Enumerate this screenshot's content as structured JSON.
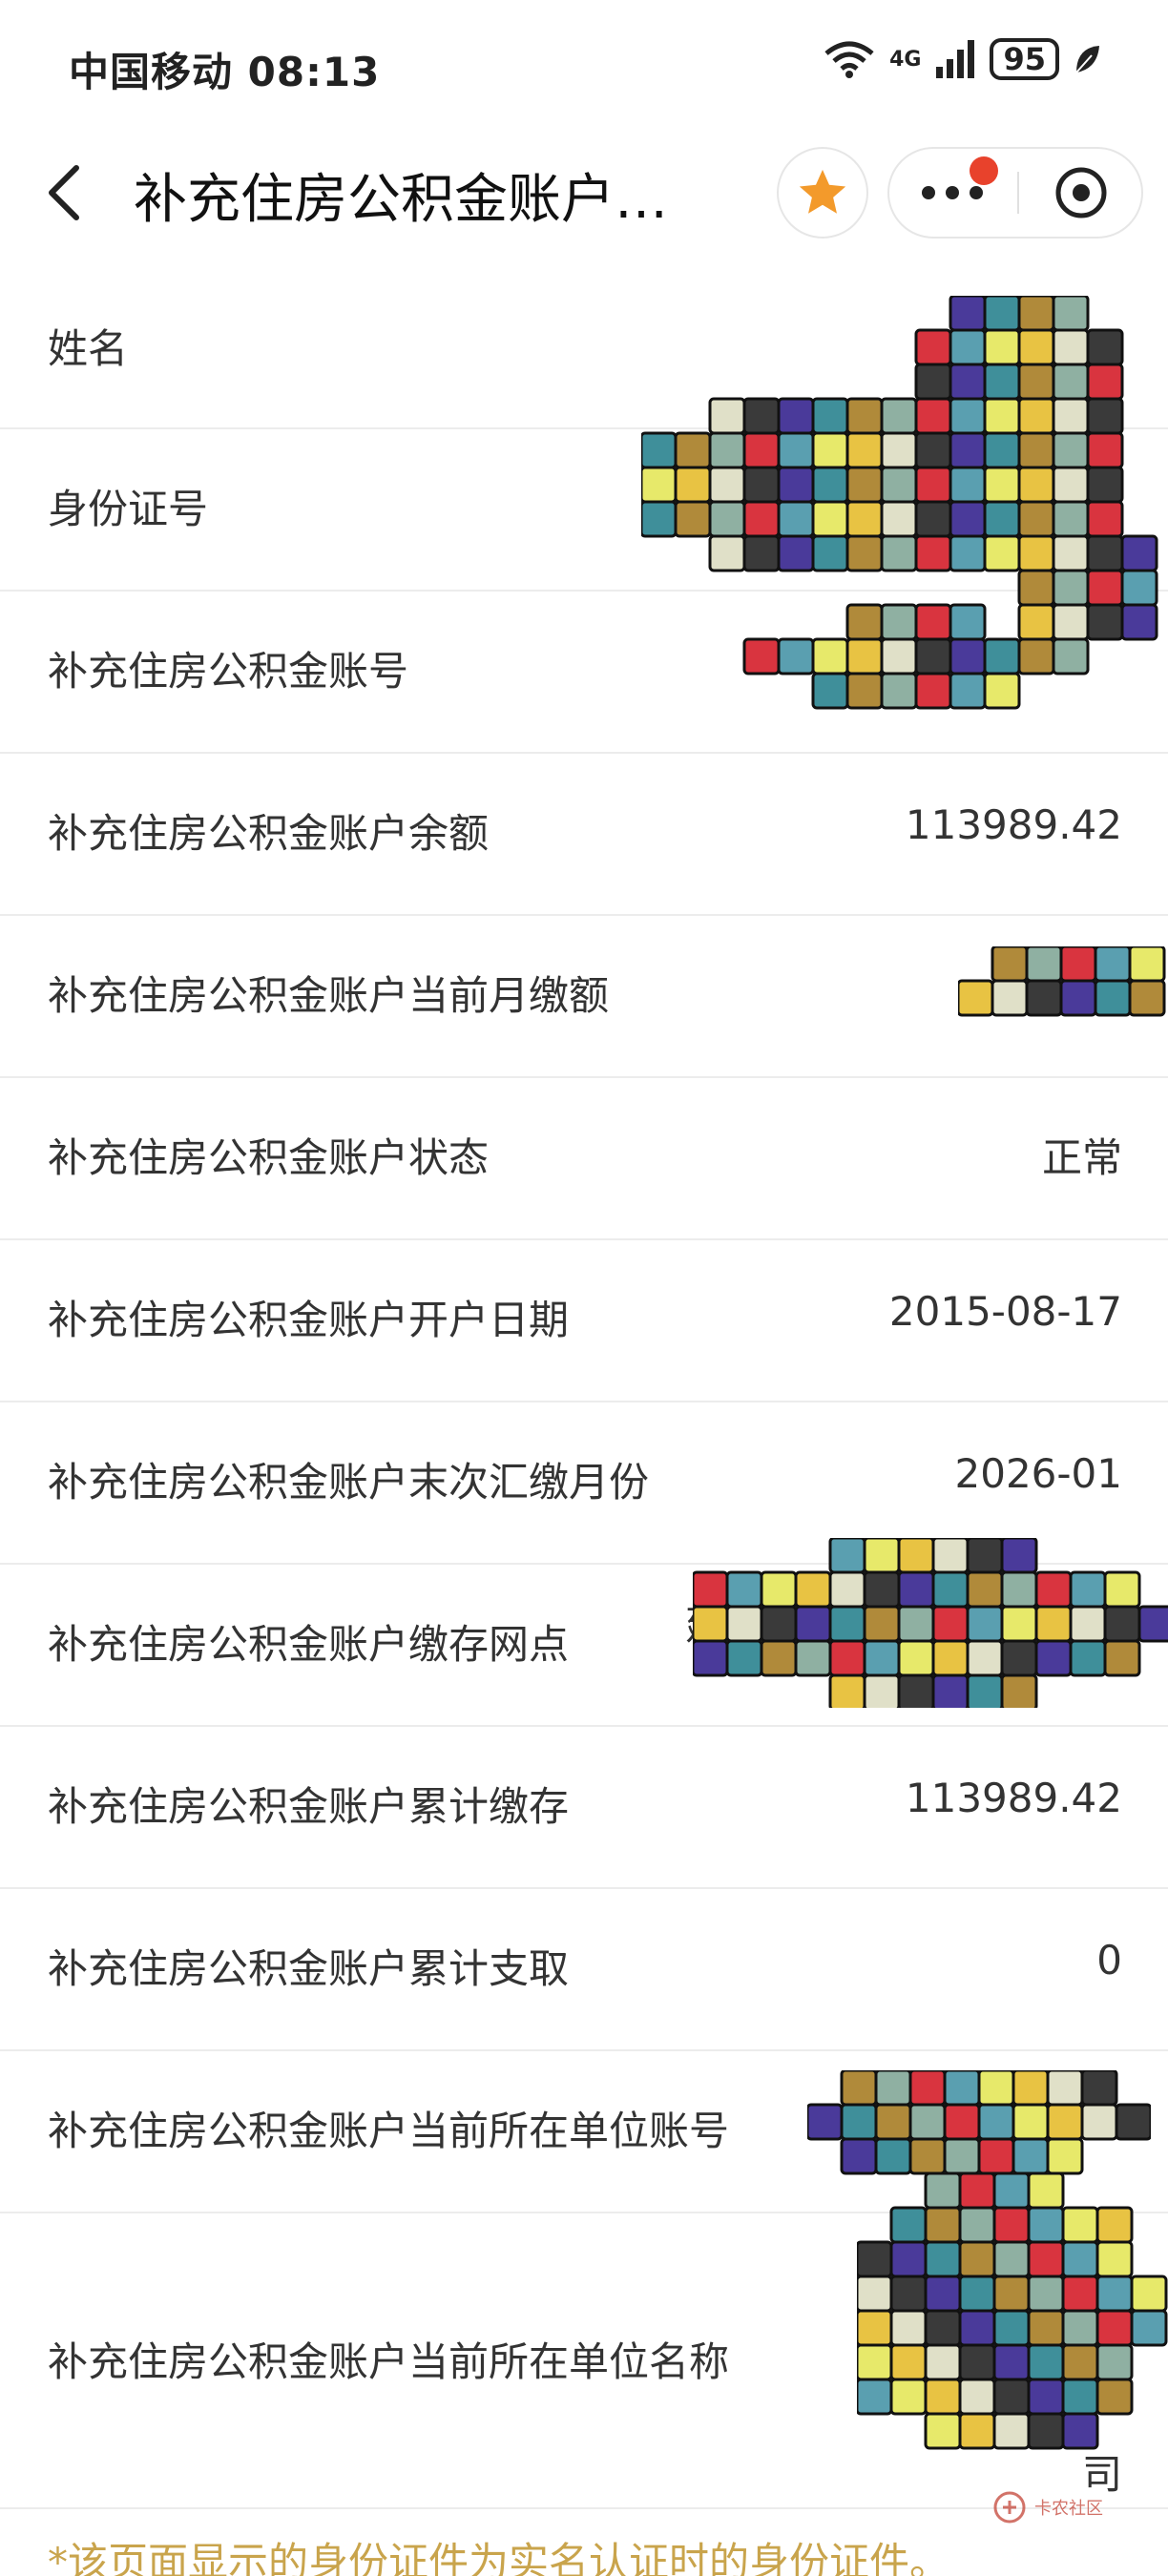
{
  "status_bar": {
    "carrier_time": "中国移动 08:13",
    "network": "4G",
    "battery": "95"
  },
  "nav": {
    "title": "补充住房公积金账户…"
  },
  "rows": [
    {
      "label": "姓名",
      "value": ""
    },
    {
      "label": "身份证号",
      "value": ""
    },
    {
      "label": "补充住房公积金账号",
      "value": ""
    },
    {
      "label": "补充住房公积金账户余额",
      "value": "113989.42"
    },
    {
      "label": "补充住房公积金账户当前月缴额",
      "value": ""
    },
    {
      "label": "补充住房公积金账户状态",
      "value": "正常"
    },
    {
      "label": "补充住房公积金账户开户日期",
      "value": "2015-08-17"
    },
    {
      "label": "补充住房公积金账户末次汇缴月份",
      "value": "2026-01"
    },
    {
      "label": "补充住房公积金账户缴存网点",
      "value": ""
    },
    {
      "label": "补充住房公积金账户累计缴存",
      "value": "113989.42"
    },
    {
      "label": "补充住房公积金账户累计支取",
      "value": "0"
    },
    {
      "label": "补充住房公积金账户当前所在单位账号",
      "value": ""
    },
    {
      "label": "补充住房公积金账户当前所在单位名称",
      "value": ""
    }
  ],
  "partial_text": {
    "branch_char": "建",
    "company_char": "司"
  },
  "footer": {
    "note": "*该页面显示的身份证件为实名认证时的身份证件。"
  },
  "watermark": {
    "text": "卡农社区"
  },
  "colors": {
    "accent_orange": "#f39a2b",
    "notification_red": "#e8422c",
    "note_gold": "#c9a44c",
    "divider": "#ececec"
  }
}
